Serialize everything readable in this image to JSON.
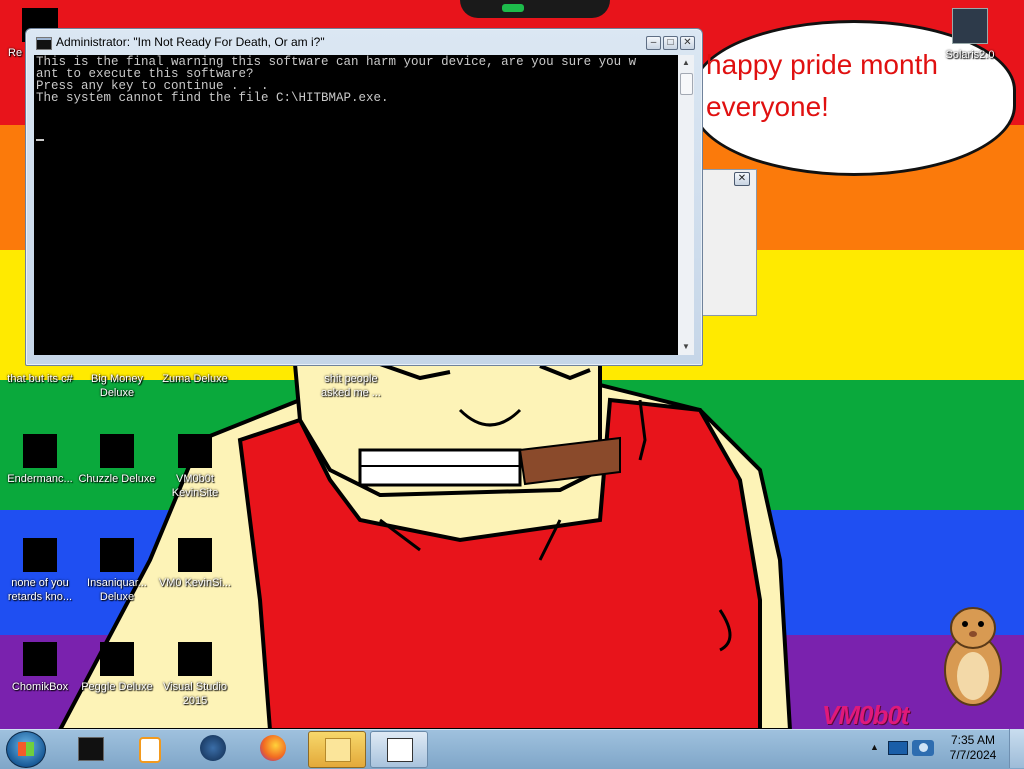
{
  "wallpaper": {
    "stripe_colors": [
      "#e8141b",
      "#fb7a0b",
      "#ffea00",
      "#0aa93c",
      "#1f4ff2",
      "#7a22ae"
    ],
    "speech_bubble_lines": [
      "happy pride month",
      "everyone!"
    ],
    "watermark": "VM0b0t"
  },
  "console": {
    "title": "Administrator:  \"Im Not Ready For Death, Or am i?\"",
    "lines": [
      "This is the final warning this software can harm your device, are you sure you w",
      "ant to execute this software?",
      "Press any key to continue . . .",
      "The system cannot find the file C:\\HITBMAP.exe."
    ]
  },
  "desktop_icons": [
    {
      "label": "Re",
      "icon": "partial-icon"
    },
    {
      "label": "Solaris2.0",
      "icon": "solaris-icon"
    },
    {
      "label": "that but its c#",
      "icon": "text-label-only"
    },
    {
      "label": "Big Money Deluxe",
      "icon": "game-icon"
    },
    {
      "label": "Zuma Deluxe",
      "icon": "game-icon"
    },
    {
      "label": "shit people asked me ...",
      "icon": "text-label-only"
    },
    {
      "label": "Endermanc...",
      "icon": "app-icon"
    },
    {
      "label": "Chuzzle Deluxe",
      "icon": "game-icon"
    },
    {
      "label": "VM0b0t KevinSite",
      "icon": "app-icon"
    },
    {
      "label": "none of you retards kno...",
      "icon": "text-label-only"
    },
    {
      "label": "Insaniquar... Deluxe",
      "icon": "game-icon"
    },
    {
      "label": "VM0 KevinSi...",
      "icon": "app-icon"
    },
    {
      "label": "ChomikBox",
      "icon": "chomikbox-icon"
    },
    {
      "label": "Peggle Deluxe",
      "icon": "game-icon"
    },
    {
      "label": "Visual Studio 2015",
      "icon": "visual-studio-icon"
    }
  ],
  "taskbar": {
    "clock_time": "7:35 AM",
    "clock_date": "7/7/2024",
    "items": [
      "command-prompt",
      "media-player",
      "globe-browser",
      "firefox",
      "explorer-folder",
      "cmd-window"
    ]
  }
}
